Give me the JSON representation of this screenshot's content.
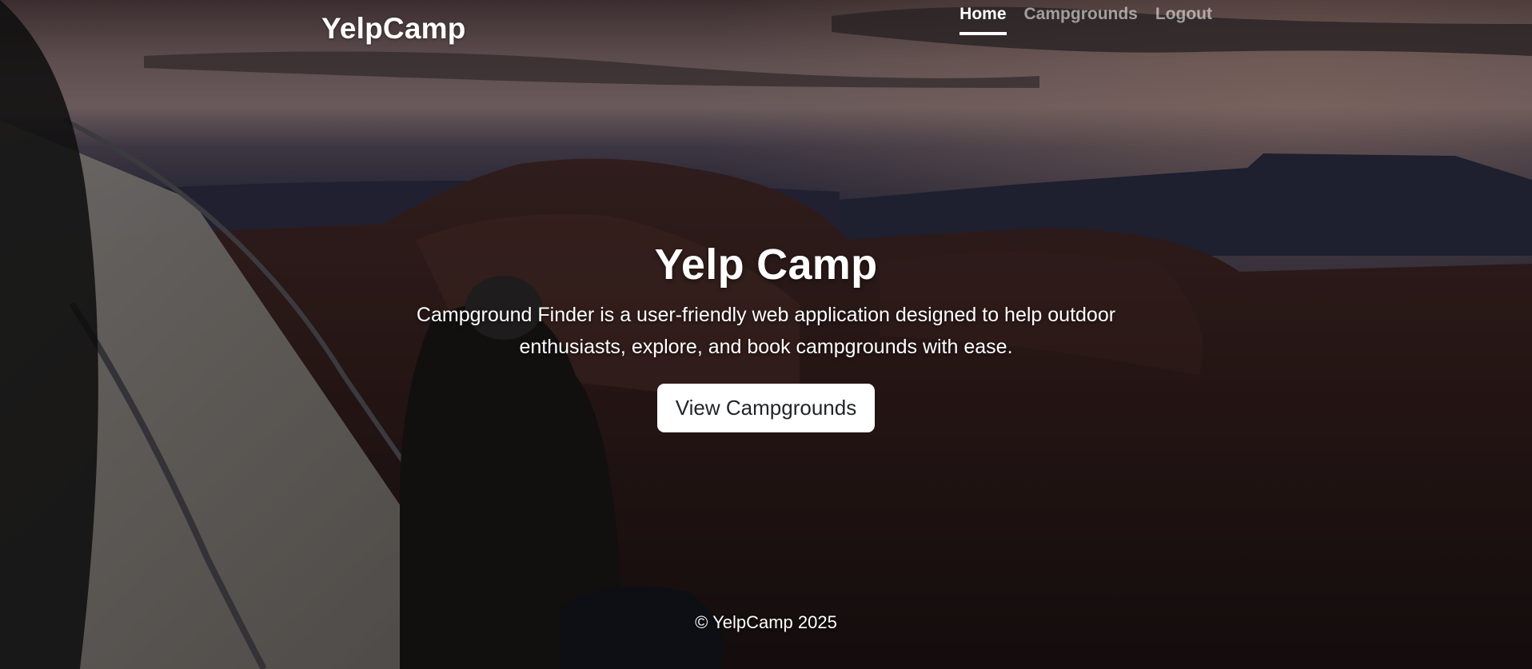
{
  "brand": "YelpCamp",
  "nav": {
    "home": "Home",
    "campgrounds": "Campgrounds",
    "logout": "Logout"
  },
  "hero": {
    "title": "Yelp Camp",
    "description": "Campground Finder is a user-friendly web application designed to help outdoor enthusiasts, explore, and book campgrounds with ease.",
    "cta_label": "View Campgrounds"
  },
  "footer": {
    "copyright": "© YelpCamp 2025"
  },
  "colors": {
    "text": "#ffffff",
    "button_bg": "#ffffff",
    "button_text": "#212529"
  },
  "background_image": "mountain-sunset-camping-photo"
}
